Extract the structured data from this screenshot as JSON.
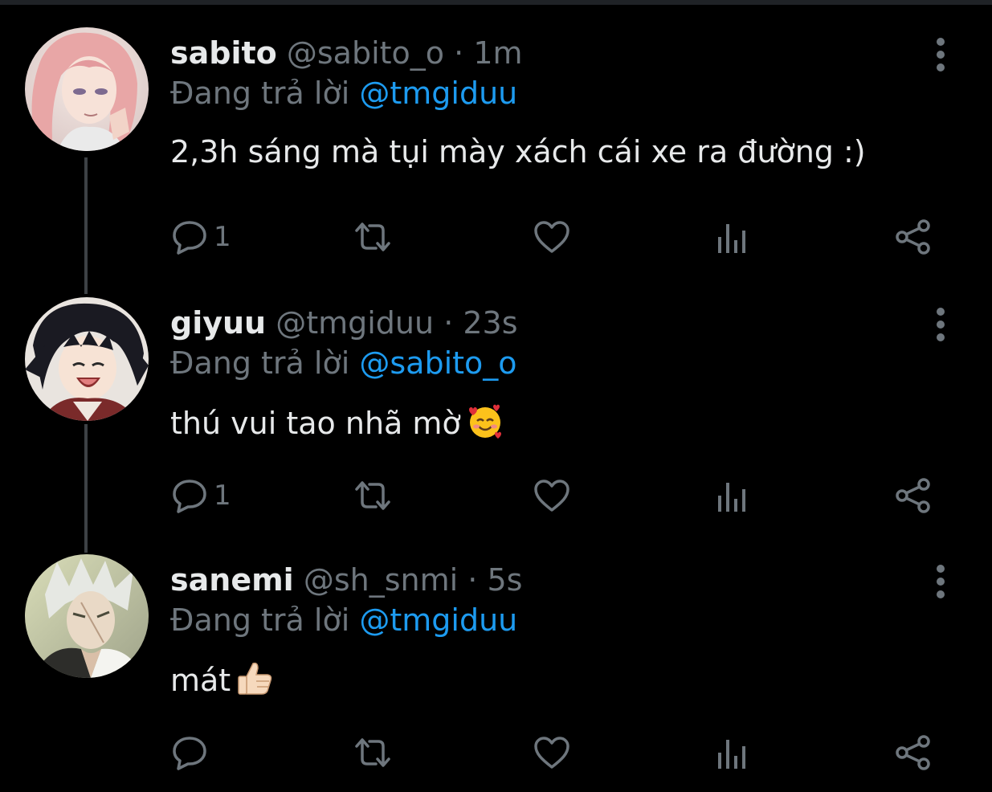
{
  "colors": {
    "background": "#000000",
    "text": "#e7e9ea",
    "muted": "#6e767d",
    "mention": "#1d9bf0",
    "thread_line": "#3d4145"
  },
  "reply_prefix": "Đang trả lời",
  "tweets": [
    {
      "name": "sabito",
      "handle": "@sabito_o",
      "separator": "·",
      "time": "1m",
      "reply_to": "@tmgiduu",
      "text": "2,3h sáng mà tụi mày xách cái xe ra đường :)",
      "emoji": "",
      "reply_count": "1",
      "icons": [
        "more-vertical-icon",
        "reply-icon",
        "retweet-icon",
        "like-icon",
        "analytics-icon",
        "share-icon"
      ]
    },
    {
      "name": "giyuu",
      "handle": "@tmgiduu",
      "separator": "·",
      "time": "23s",
      "reply_to": "@sabito_o",
      "text": "thú vui tao nhã mờ",
      "emoji": "smiling-face-with-hearts-emoji",
      "reply_count": "1",
      "icons": [
        "more-vertical-icon",
        "reply-icon",
        "retweet-icon",
        "like-icon",
        "analytics-icon",
        "share-icon"
      ]
    },
    {
      "name": "sanemi",
      "handle": "@sh_snmi",
      "separator": "·",
      "time": "5s",
      "reply_to": "@tmgiduu",
      "text": "mát",
      "emoji": "thumbs-up-emoji",
      "reply_count": "",
      "icons": [
        "more-vertical-icon",
        "reply-icon",
        "retweet-icon",
        "like-icon",
        "analytics-icon",
        "share-icon"
      ]
    }
  ]
}
